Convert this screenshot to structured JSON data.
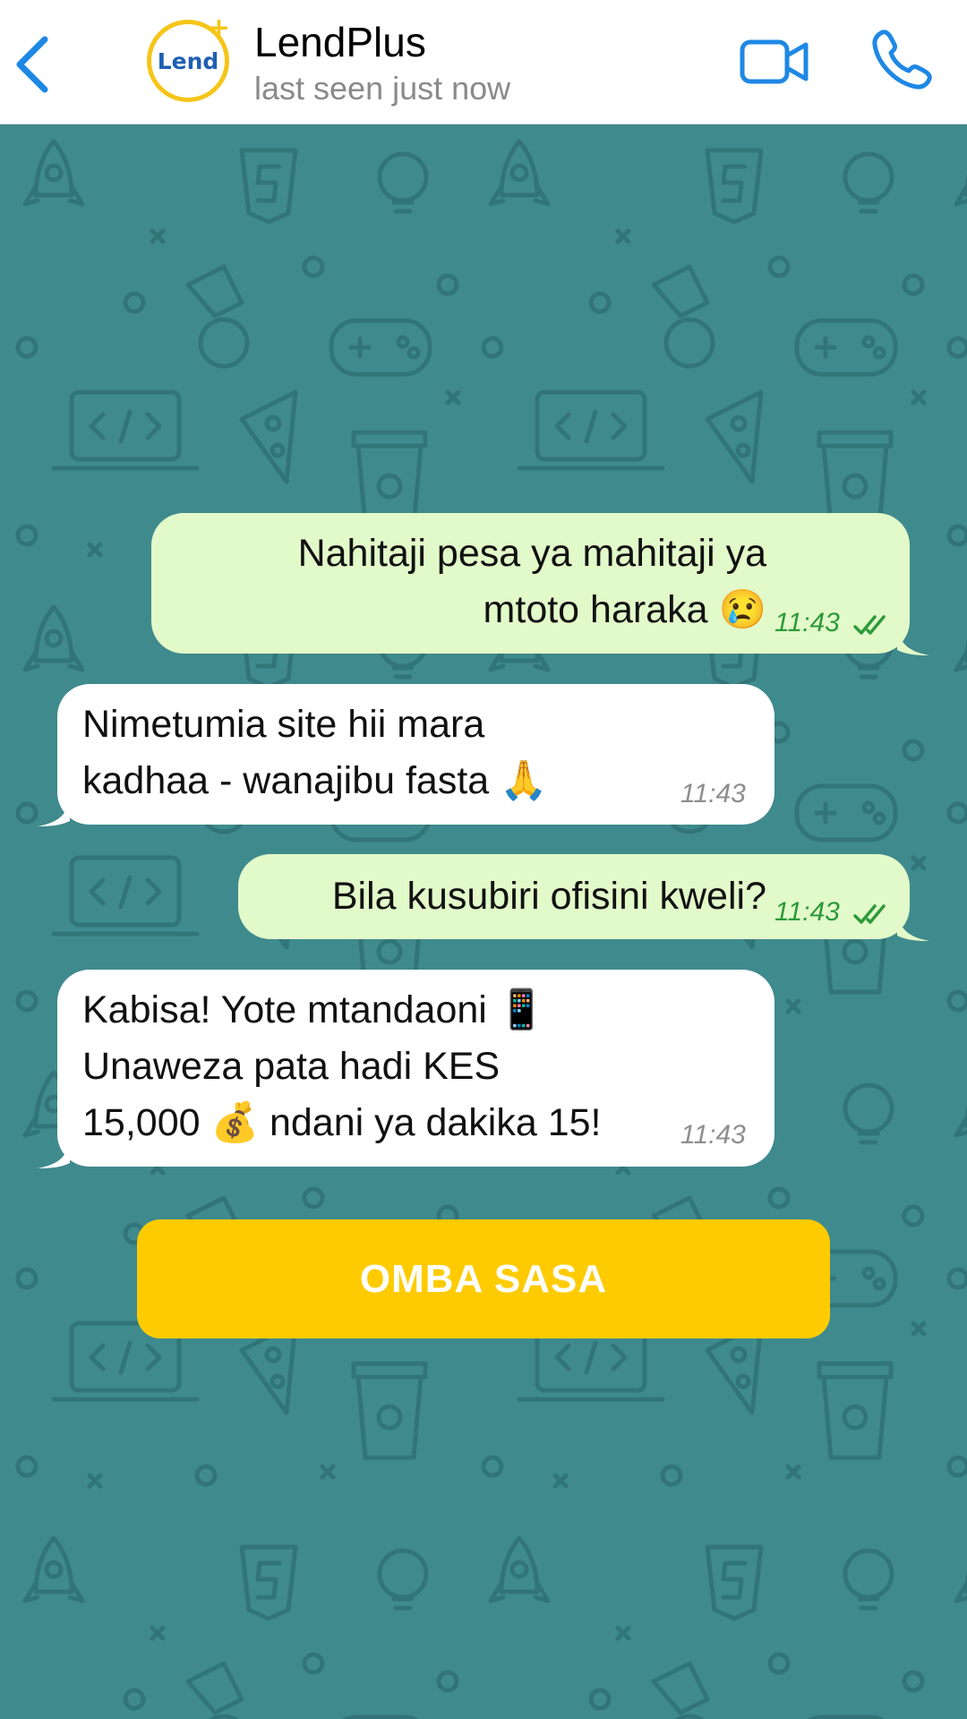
{
  "header": {
    "contact_name": "LendPlus",
    "status": "last seen just now",
    "avatar_text": "Lend",
    "avatar_plus": "+",
    "icons": [
      "back-chevron-icon",
      "video-camera-icon",
      "phone-icon"
    ]
  },
  "messages": [
    {
      "direction": "outgoing",
      "lines": [
        "Nahitaji pesa ya mahitaji ya",
        "mtoto haraka 😢"
      ],
      "time": "11:43",
      "status": "read"
    },
    {
      "direction": "incoming",
      "lines": [
        "Nimetumia site hii mara",
        "kadhaa - wanajibu fasta 🙏"
      ],
      "time": "11:43"
    },
    {
      "direction": "outgoing",
      "lines": [
        "Bila kusubiri ofisini kweli?"
      ],
      "time": "11:43",
      "status": "read"
    },
    {
      "direction": "incoming",
      "lines": [
        "Kabisa! Yote mtandaoni 📱",
        "Unaweza pata hadi KES",
        "15,000 💰 ndani ya dakika 15!"
      ],
      "time": "11:43"
    }
  ],
  "cta": {
    "label": "OMBA SASA"
  },
  "colors": {
    "header_bg": "#ffffff",
    "accent_blue": "#1e88e5",
    "wallpaper": "#3f8a8d",
    "wallpaper_icons": "#2e6f74",
    "outgoing_bubble": "#e2f9c9",
    "incoming_bubble": "#ffffff",
    "read_ticks": "#2d9a3a",
    "cta_bg": "#fecb00",
    "cta_text": "#ffffff",
    "brand_yellow": "#f5c518",
    "brand_blue": "#1f5fb4"
  }
}
